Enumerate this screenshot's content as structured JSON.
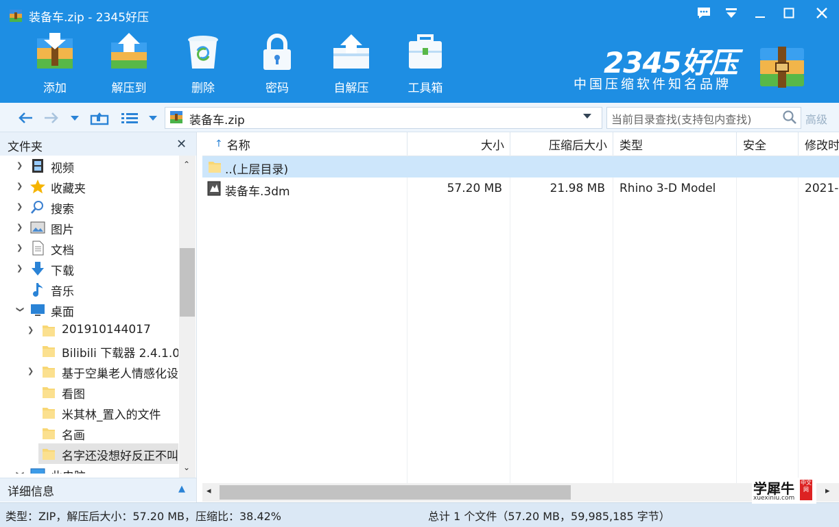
{
  "window": {
    "title": "装备车.zip - 2345好压",
    "buttons": [
      "feedback-icon",
      "menu-dropdown-icon",
      "minimize-icon",
      "maximize-icon",
      "close-icon"
    ]
  },
  "toolbar": {
    "items": [
      {
        "label": "添加",
        "icon": "add-icon"
      },
      {
        "label": "解压到",
        "icon": "extract-to-icon"
      },
      {
        "label": "删除",
        "icon": "delete-icon"
      },
      {
        "label": "密码",
        "icon": "password-lock-icon"
      },
      {
        "label": "自解压",
        "icon": "self-extract-icon"
      },
      {
        "label": "工具箱",
        "icon": "toolbox-icon"
      }
    ]
  },
  "brand": {
    "name": "2345好压",
    "slogan": "中国压缩软件知名品牌"
  },
  "nav": {
    "address": "装备车.zip",
    "search_placeholder": "当前目录查找(支持包内查找)",
    "advanced": "高级"
  },
  "sidebar": {
    "title": "文件夹",
    "items": [
      {
        "label": "视频",
        "icon": "video-icon",
        "arrow": "›"
      },
      {
        "label": "收藏夹",
        "icon": "star-icon",
        "arrow": "›"
      },
      {
        "label": "搜索",
        "icon": "search-icon",
        "arrow": "›"
      },
      {
        "label": "图片",
        "icon": "picture-icon",
        "arrow": "›"
      },
      {
        "label": "文档",
        "icon": "document-icon",
        "arrow": "›"
      },
      {
        "label": "下载",
        "icon": "download-icon",
        "arrow": "›"
      },
      {
        "label": "音乐",
        "icon": "music-icon",
        "arrow": ""
      },
      {
        "label": "桌面",
        "icon": "desktop-icon",
        "arrow": "⌄"
      },
      {
        "label": "201910144017",
        "icon": "folder-icon",
        "arrow": "›"
      },
      {
        "label": "Bilibili 下载器 2.4.1.0",
        "icon": "folder-icon",
        "arrow": ""
      },
      {
        "label": "基于空巢老人情感化设",
        "icon": "folder-icon",
        "arrow": "›"
      },
      {
        "label": "看图",
        "icon": "folder-icon",
        "arrow": ""
      },
      {
        "label": "米其林_置入的文件",
        "icon": "folder-icon",
        "arrow": ""
      },
      {
        "label": "名画",
        "icon": "folder-icon",
        "arrow": ""
      },
      {
        "label": "名字还没想好反正不叫",
        "icon": "folder-icon",
        "arrow": ""
      },
      {
        "label": "此电脑",
        "icon": "computer-icon",
        "arrow": "⌄"
      }
    ],
    "details_label": "详细信息"
  },
  "filelist": {
    "columns": [
      "名称",
      "大小",
      "压缩后大小",
      "类型",
      "安全",
      "修改时"
    ],
    "sort_indicator": "↑",
    "rows": [
      {
        "name": "..(上层目录)",
        "size": "",
        "packed": "",
        "type": "",
        "safe": "",
        "modified": ""
      },
      {
        "name": "装备车.3dm",
        "size": "57.20 MB",
        "packed": "21.98 MB",
        "type": "Rhino 3-D Model",
        "safe": "",
        "modified": "2021-"
      }
    ]
  },
  "status": {
    "left": "类型：ZIP，解压后大小：57.20 MB，压缩比：38.42%",
    "right": "总计 1 个文件（57.20 MB，59,985,185 字节）"
  },
  "watermark": {
    "main": "学犀牛",
    "sub": "xuexiniu.com",
    "seal": "中文网"
  }
}
